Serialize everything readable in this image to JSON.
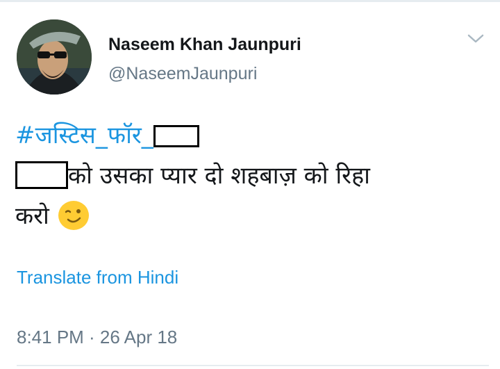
{
  "user": {
    "display_name": "Naseem Khan Jaunpuri",
    "handle": "@NaseemJaunpuri",
    "avatar_icon": "profile-photo"
  },
  "tweet": {
    "hashtag": "#जस्टिस_फॉर_",
    "line2_text": "को उसका प्यार दो शहबाज़ को रिहा",
    "line3_text": "करो",
    "emoji_icon": "winking-face-emoji"
  },
  "translate_label": "Translate from Hindi",
  "timestamp": "8:41 PM · 26 Apr 18",
  "menu_icon": "chevron-down-icon",
  "colors": {
    "link": "#1b95e0",
    "secondary_text": "#657786",
    "primary_text": "#14171a",
    "divider": "#e6ecf0"
  }
}
